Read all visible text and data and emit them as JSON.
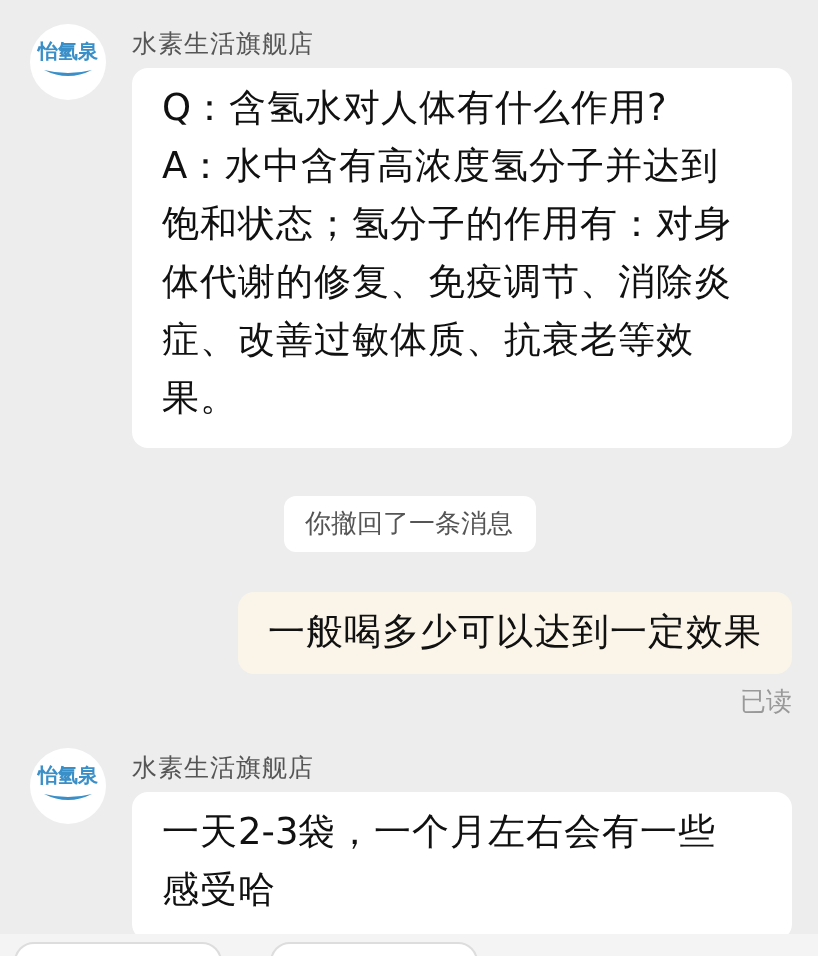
{
  "messages": [
    {
      "kind": "incoming",
      "sender": "水素生活旗舰店",
      "avatar_logo": "怡氫泉",
      "paragraphs": [
        "Q：含氢水对人体有什么作用?",
        "A：水中含有高浓度氢分子并达到饱和状态；氢分子的作用有：对身体代谢的修复、免疫调节、消除炎症、改善过敏体质、抗衰老等效果。"
      ]
    },
    {
      "kind": "notice",
      "text": "你撤回了一条消息"
    },
    {
      "kind": "outgoing",
      "paragraphs": [
        "一般喝多少可以达到一定效果"
      ],
      "status": "已读"
    },
    {
      "kind": "incoming",
      "sender": "水素生活旗舰店",
      "avatar_logo": "怡氫泉",
      "paragraphs": [
        "一天2-3袋，一个月左右会有一些感受哈"
      ]
    }
  ]
}
